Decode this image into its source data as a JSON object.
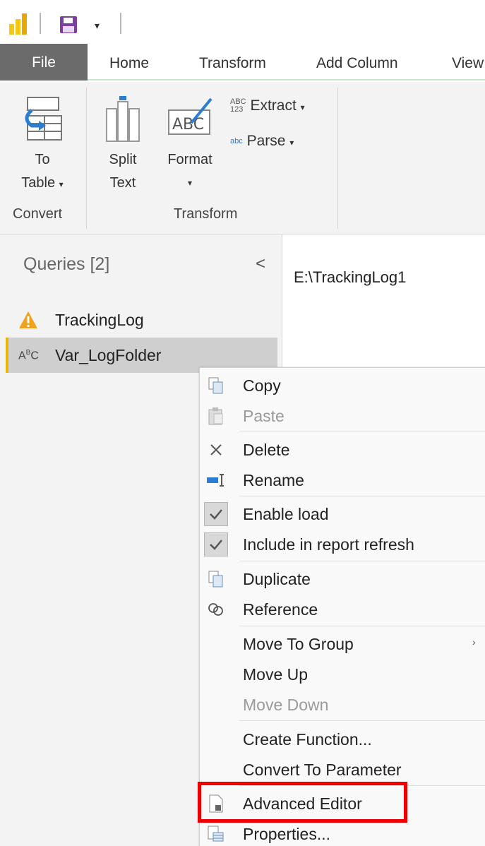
{
  "quick_access": {
    "app_icon": "power-bi-icon",
    "save_icon": "save-icon",
    "customize_icon": "dropdown-arrow",
    "customize_glyph": "▾"
  },
  "tabs": [
    {
      "label": "File"
    },
    {
      "label": "Home"
    },
    {
      "label": "Transform"
    },
    {
      "label": "Add Column"
    },
    {
      "label": "View"
    }
  ],
  "ribbon": {
    "convert": {
      "to_table_line1": "To",
      "to_table_line2": "Table",
      "group_label": "Convert"
    },
    "transform": {
      "split_line1": "Split",
      "split_line2": "Text",
      "format_label": "Format",
      "extract_label": "Extract",
      "parse_label": "Parse",
      "group_label": "Transform"
    }
  },
  "queries": {
    "title": "Queries [2]",
    "collapse_glyph": "<",
    "items": [
      {
        "label": "TrackingLog",
        "icon": "warning-icon"
      },
      {
        "label": "Var_LogFolder",
        "icon": "text-type-icon"
      }
    ]
  },
  "main": {
    "value": "E:\\TrackingLog1"
  },
  "context_menu": {
    "items": [
      {
        "label": "Copy",
        "icon": "copy-icon"
      },
      {
        "label": "Paste",
        "icon": "paste-icon",
        "disabled": true
      },
      {
        "label": "Delete",
        "icon": "delete-icon"
      },
      {
        "label": "Rename",
        "icon": "rename-icon"
      },
      {
        "label": "Enable load",
        "icon": "check-icon",
        "checked": true
      },
      {
        "label": "Include in report refresh",
        "icon": "check-icon",
        "checked": true
      },
      {
        "label": "Duplicate",
        "icon": "duplicate-icon"
      },
      {
        "label": "Reference",
        "icon": "reference-icon"
      },
      {
        "label": "Move To Group",
        "submenu": true,
        "submenu_glyph": "›"
      },
      {
        "label": "Move Up"
      },
      {
        "label": "Move Down",
        "disabled": true
      },
      {
        "label": "Create Function..."
      },
      {
        "label": "Convert To Parameter"
      },
      {
        "label": "Advanced Editor",
        "icon": "advanced-editor-icon",
        "highlighted": true
      },
      {
        "label": "Properties...",
        "icon": "properties-icon"
      }
    ]
  },
  "colors": {
    "highlight_box": "#ee0000",
    "selected_marker": "#e8b800",
    "file_tab": "#6b6b6b"
  }
}
